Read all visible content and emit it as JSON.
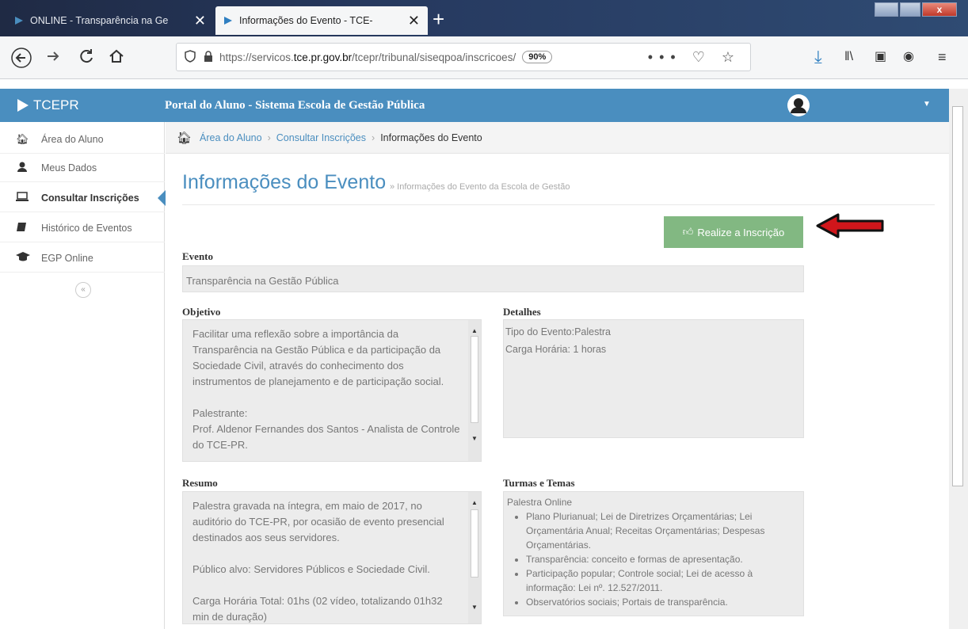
{
  "browser": {
    "tabs": [
      {
        "title": "ONLINE - Transparência na Ge",
        "active": false
      },
      {
        "title": "Informações do Evento - TCE-",
        "active": true
      }
    ],
    "url_prefix": "https://servicos.",
    "url_domain": "tce.pr.gov.br",
    "url_path": "/tcepr/tribunal/siseqpoa/inscricoes/",
    "zoom": "90%"
  },
  "header": {
    "brand": "TCEPR",
    "portal_title": "Portal do Aluno - Sistema Escola de Gestão Pública",
    "accent_color": "#4a8ebf"
  },
  "sidebar": {
    "items": [
      {
        "label": "Área do Aluno",
        "icon": "home-icon"
      },
      {
        "label": "Meus Dados",
        "icon": "user-icon"
      },
      {
        "label": "Consultar Inscrições",
        "icon": "laptop-icon",
        "active": true
      },
      {
        "label": "Histórico de Eventos",
        "icon": "book-icon"
      },
      {
        "label": "EGP Online",
        "icon": "graduation-cap-icon"
      }
    ]
  },
  "breadcrumb": {
    "items": [
      "Área do Aluno",
      "Consultar Inscrições"
    ],
    "current": "Informações do Evento"
  },
  "page": {
    "title": "Informações do Evento",
    "subtitle": "» Informações do Evento da Escola de Gestão",
    "enroll_button": "Realize a Inscrição",
    "enroll_color": "#82b882"
  },
  "evento": {
    "label": "Evento",
    "value": "Transparência na Gestão Pública"
  },
  "objetivo": {
    "label": "Objetivo",
    "paragraphs": [
      "Facilitar uma reflexão sobre a importância da Transparência na Gestão Pública e da participação da Sociedade Civil, através do conhecimento dos instrumentos de planejamento e de participação social.",
      "Palestrante:",
      "Prof. Aldenor Fernandes dos Santos - Analista de Controle do TCE-PR."
    ]
  },
  "detalhes": {
    "label": "Detalhes",
    "tipo": "Tipo do Evento:Palestra",
    "carga": "Carga Horária: 1 horas"
  },
  "resumo": {
    "label": "Resumo",
    "paragraphs": [
      "Palestra gravada na íntegra, em maio de 2017, no auditório do TCE-PR, por ocasião de evento presencial destinados aos seus servidores.",
      "Público alvo: Servidores Públicos e Sociedade Civil.",
      "Carga Horária Total: 01hs (02 vídeo, totalizando 01h32 min de duração)"
    ]
  },
  "turmas": {
    "label": "Turmas e Temas",
    "group": "Palestra Online",
    "items": [
      "Plano Plurianual; Lei de Diretrizes Orçamentárias; Lei Orçamentária Anual; Receitas Orçamentárias; Despesas Orçamentárias.",
      "Transparência: conceito e formas de apresentação.",
      "Participação popular; Controle social; Lei de acesso à informação: Lei nº. 12.527/2011.",
      "Observatórios sociais; Portais de transparência."
    ]
  }
}
